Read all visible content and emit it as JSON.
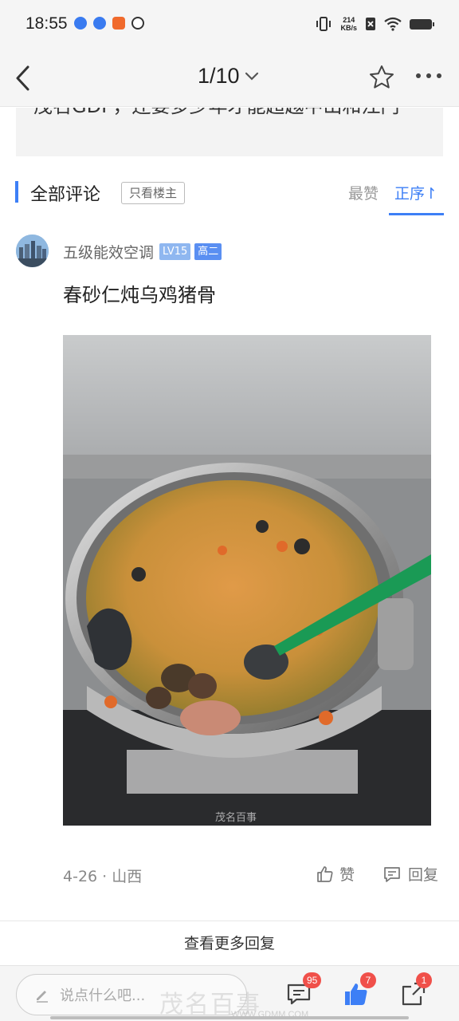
{
  "status_bar": {
    "time": "18:55",
    "net_speed_value": "214",
    "net_speed_unit": "KB/s"
  },
  "nav": {
    "page_indicator": "1/10"
  },
  "quote": {
    "text": "茂名GDP，还要多少年才能超越中山和江门"
  },
  "comments_header": {
    "title": "全部评论",
    "only_op_label": "只看楼主",
    "sort_hot_label": "最赞",
    "sort_asc_label": "正序↾"
  },
  "comment": {
    "username": "五级能效空调",
    "level_badge": "LV15",
    "grade_badge": "高二",
    "text": "春砂仁炖乌鸡猪骨",
    "date_location": "4-26 · 山西",
    "like_label": "赞",
    "reply_label": "回复",
    "photo_watermark": "茂名百事"
  },
  "more_replies_label": "查看更多回复",
  "bottom_bar": {
    "input_placeholder": "说点什么吧...",
    "comment_count": "95",
    "like_count": "7",
    "share_count": "1"
  },
  "watermark": {
    "text": "茂名百事",
    "url": "WWW.GDMM.COM"
  },
  "colors": {
    "accent": "#3d7ff6",
    "badge_red": "#f0504a"
  }
}
